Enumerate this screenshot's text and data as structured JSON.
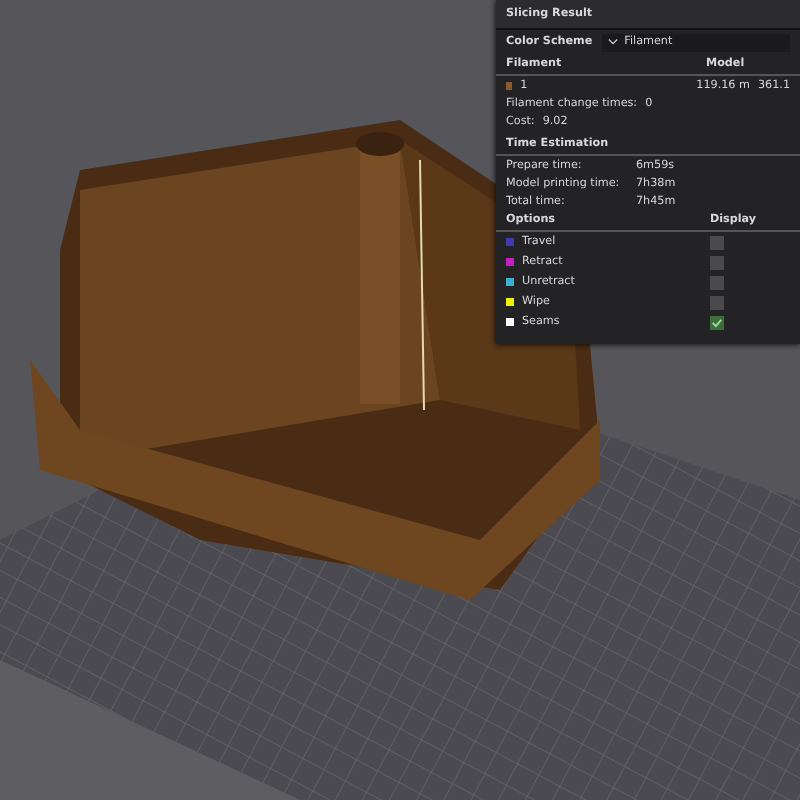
{
  "panel": {
    "title": "Slicing Result",
    "color_scheme": {
      "label": "Color Scheme",
      "value": "Filament"
    },
    "filament_header": {
      "column_1": "Filament",
      "column_2": "Model"
    },
    "filaments": [
      {
        "name": "1",
        "color": "#8a5a30",
        "length": "119.16 m",
        "column_3": "361.1"
      }
    ],
    "change_times": {
      "label": "Filament change times:",
      "value": "0"
    },
    "cost": {
      "label": "Cost:",
      "value": "9.02"
    },
    "time_title": "Time Estimation",
    "times": [
      {
        "label": "Prepare time:",
        "value": "6m59s"
      },
      {
        "label": "Model printing time:",
        "value": "7h38m"
      },
      {
        "label": "Total time:",
        "value": "7h45m"
      }
    ],
    "options_header": {
      "column_1": "Options",
      "column_2": "Display"
    },
    "options": [
      {
        "name": "Travel",
        "color": "#3d3db0",
        "checked": false
      },
      {
        "name": "Retract",
        "color": "#c41ec4",
        "checked": false
      },
      {
        "name": "Unretract",
        "color": "#3ab0d8",
        "checked": false
      },
      {
        "name": "Wipe",
        "color": "#f0f000",
        "checked": false
      },
      {
        "name": "Seams",
        "color": "#ffffff",
        "checked": true
      }
    ]
  }
}
